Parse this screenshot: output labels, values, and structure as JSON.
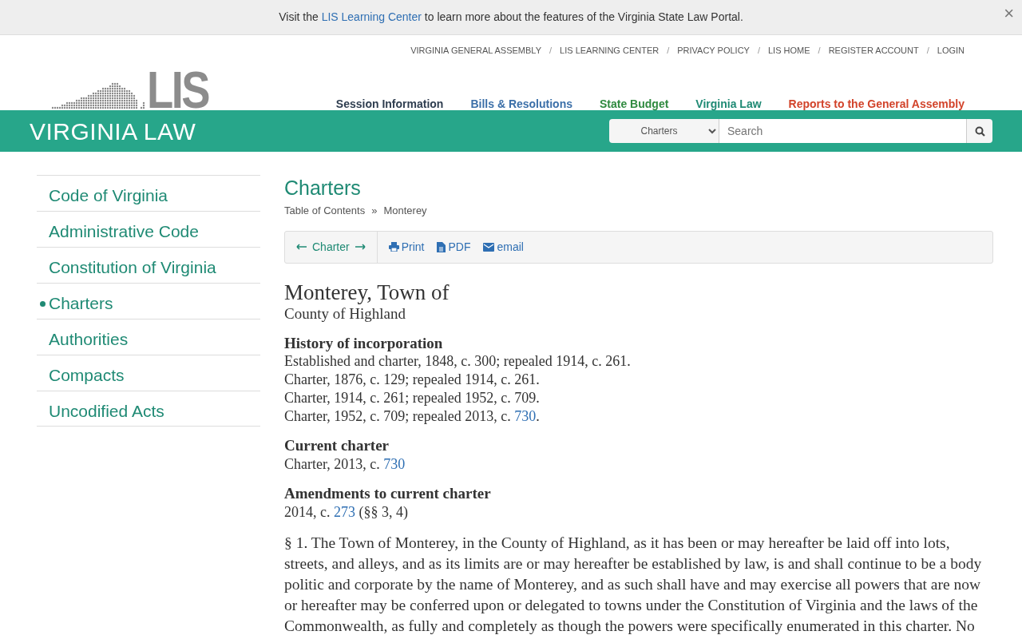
{
  "banner": {
    "text": "Visit the ",
    "link": "LIS Learning Center",
    "after": " to learn more about the features of the Virginia State Law Portal.",
    "close": "×"
  },
  "utility_links": [
    {
      "label": "VIRGINIA GENERAL ASSEMBLY"
    },
    {
      "separator": "/",
      "label": "LIS LEARNING CENTER"
    },
    {
      "separator": "/",
      "label": "PRIVACY POLICY"
    },
    {
      "separator": "/",
      "label": "LIS HOME"
    },
    {
      "separator": "/",
      "label": "REGISTER ACCOUNT"
    },
    {
      "separator": "/",
      "label": "LOGIN"
    }
  ],
  "logo": {
    "text": "LIS"
  },
  "main_nav": [
    {
      "label": "Session Information",
      "color": "#2e3d4f"
    },
    {
      "label": "Bills & Resolutions",
      "color": "#3b6fa8"
    },
    {
      "label": "State Budget",
      "color": "#2f8a3f"
    },
    {
      "label": "Virginia Law",
      "color": "#1f8a74"
    },
    {
      "label": "Reports to the General Assembly",
      "color": "#d2432a"
    }
  ],
  "section_title": "VIRGINIA LAW",
  "search": {
    "scope": "Charters",
    "placeholder": "Search"
  },
  "sidebar": {
    "items": [
      {
        "label": "Code of Virginia",
        "selected": false
      },
      {
        "label": "Administrative Code",
        "selected": false
      },
      {
        "label": "Constitution of Virginia",
        "selected": false
      },
      {
        "label": "Charters",
        "selected": true
      },
      {
        "label": "Authorities",
        "selected": false
      },
      {
        "label": "Compacts",
        "selected": false
      },
      {
        "label": "Uncodified Acts",
        "selected": false
      }
    ]
  },
  "content": {
    "heading": "Charters",
    "breadcrumb": [
      {
        "label": "Table of Contents"
      },
      {
        "separator": "»",
        "label": "Monterey"
      }
    ],
    "toolbar": {
      "pager": "Charter",
      "actions": [
        {
          "kind": "print",
          "label": "Print"
        },
        {
          "kind": "pdf",
          "label": "PDF"
        },
        {
          "kind": "email",
          "label": "email"
        }
      ]
    },
    "title": "Monterey, Town of",
    "subtitle": "County of Highland",
    "sections": [
      {
        "heading": "History of incorporation",
        "lines": [
          {
            "text": "Established and charter, 1848, c. 300; repealed 1914, c. 261."
          },
          {
            "text": "Charter, 1876, c. 129; repealed 1914, c. 261."
          },
          {
            "text": "Charter, 1914, c. 261; repealed 1952, c. 709."
          },
          {
            "text": "Charter, 1952, c. 709; repealed 2013, c. ",
            "link": "730",
            "after": "."
          }
        ]
      },
      {
        "heading": "Current charter",
        "lines": [
          {
            "text": "Charter, 2013, c. ",
            "link": "730"
          }
        ]
      },
      {
        "heading": "Amendments to current charter",
        "lines": [
          {
            "text": "2014, c. ",
            "link": "273",
            "after": " (§§ 3, 4)"
          }
        ]
      }
    ],
    "paragraph": "§ 1. The Town of Monterey, in the County of Highland, as it has been or may hereafter be laid off into lots, streets, and alleys, and as its limits are or may hereafter be established by law, is and shall continue to be a body politic and corporate by the name of Monterey, and as such shall have and may exercise all powers that are now or hereafter may be conferred upon or delegated to towns under the Constitution of Virginia and the laws of the Commonwealth, as fully and completely as though the powers were specifically enumerated in this charter. No"
  }
}
